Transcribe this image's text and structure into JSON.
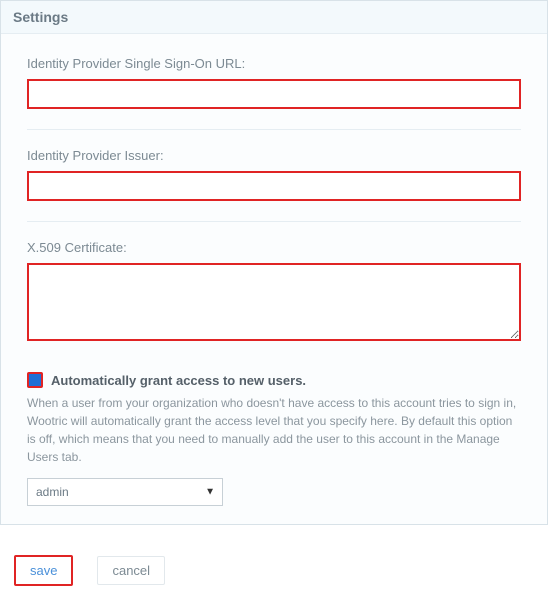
{
  "panel": {
    "title": "Settings",
    "fields": {
      "sso_url": {
        "label": "Identity Provider Single Sign-On URL:",
        "value": ""
      },
      "issuer": {
        "label": "Identity Provider Issuer:",
        "value": ""
      },
      "cert": {
        "label": "X.509 Certificate:",
        "value": ""
      }
    },
    "auto_grant": {
      "checked": true,
      "label": "Automatically grant access to new users.",
      "help": "When a user from your organization who doesn't have access to this account tries to sign in, Wootric will automatically grant the access level that you specify here. By default this option is off, which means that you need to manually add the user to this account in the Manage Users tab.",
      "role_selected": "admin"
    }
  },
  "actions": {
    "save": "save",
    "cancel": "cancel"
  }
}
